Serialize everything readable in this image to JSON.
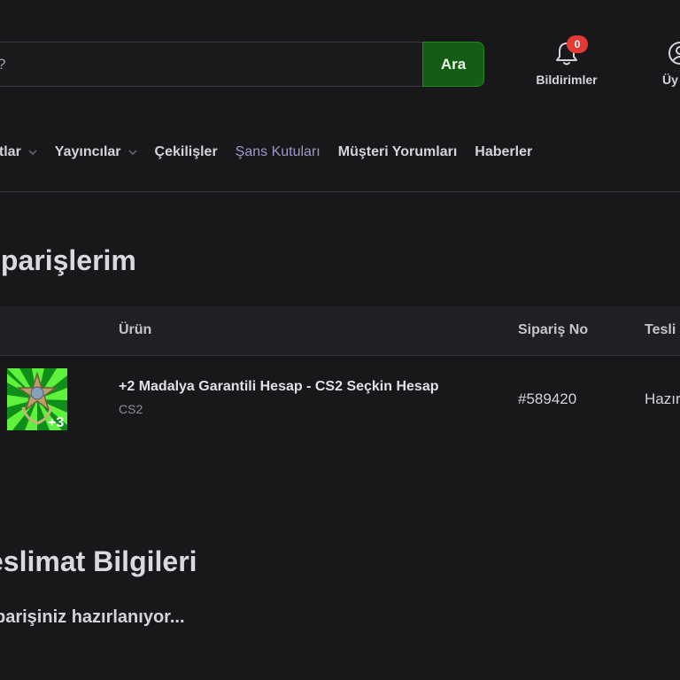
{
  "header": {
    "search": {
      "value": "?",
      "button_label": "Ara"
    },
    "notifications": {
      "label": "Bildirimler",
      "count": "0"
    },
    "user": {
      "label": "Üy"
    }
  },
  "nav": {
    "items": [
      {
        "label": "atlar",
        "has_dropdown": true,
        "highlight": false
      },
      {
        "label": "Yayıncılar",
        "has_dropdown": true,
        "highlight": false
      },
      {
        "label": "Çekilişler",
        "has_dropdown": false,
        "highlight": false
      },
      {
        "label": "Şans Kutuları",
        "has_dropdown": false,
        "highlight": true
      },
      {
        "label": "Müşteri Yorumları",
        "has_dropdown": false,
        "highlight": false
      },
      {
        "label": "Haberler",
        "has_dropdown": false,
        "highlight": false
      }
    ]
  },
  "orders": {
    "title": "iparişlerim",
    "columns": {
      "product": "Ürün",
      "order_no": "Sipariş No",
      "delivery": "Tesli"
    },
    "rows": [
      {
        "product_name": "+2 Madalya Garantili Hesap - CS2 Seçkin Hesap",
        "category": "CS2",
        "order_no": "#589420",
        "status": "Hazır"
      }
    ]
  },
  "delivery": {
    "title": "eslimat Bilgileri",
    "message": "parişiniz hazırlanıyor..."
  },
  "colors": {
    "background": "#18181b",
    "accent_green": "#155d14",
    "badge_red": "#e53935",
    "highlight_nav": "#9c97c7"
  }
}
